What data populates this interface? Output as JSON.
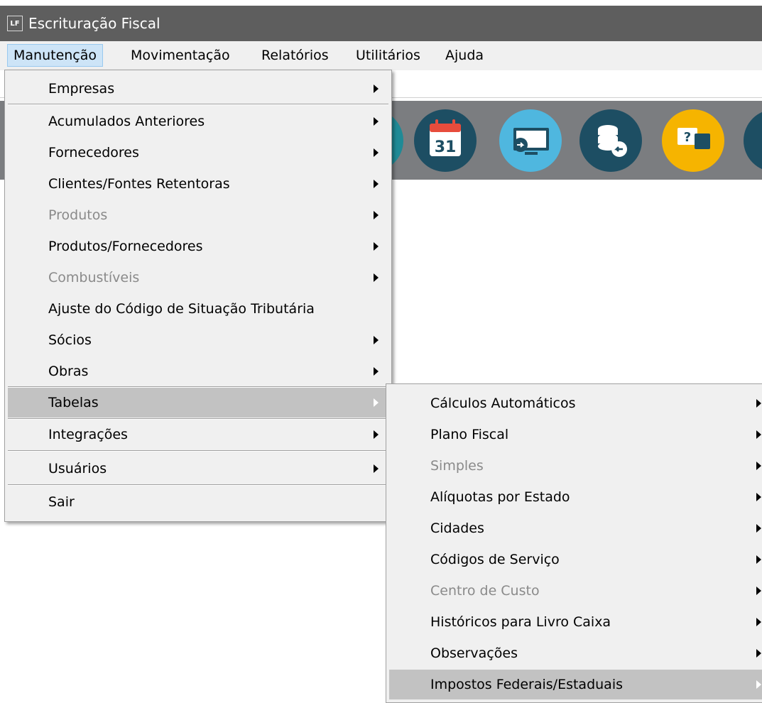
{
  "window": {
    "app_icon_text": "LF",
    "title": "Escrituração Fiscal"
  },
  "menubar": [
    "Manutenção",
    "Movimentação",
    "Relatórios",
    "Utilitários",
    "Ajuda"
  ],
  "toolbar": {
    "calendar_day": "31"
  },
  "menu_manutencao": {
    "items": [
      {
        "label": "Empresas",
        "has_submenu": true,
        "enabled": true
      },
      {
        "label": "Acumulados Anteriores",
        "has_submenu": true,
        "enabled": true
      },
      {
        "label": "Fornecedores",
        "has_submenu": true,
        "enabled": true
      },
      {
        "label": "Clientes/Fontes Retentoras",
        "has_submenu": true,
        "enabled": true
      },
      {
        "label": "Produtos",
        "has_submenu": true,
        "enabled": false
      },
      {
        "label": "Produtos/Fornecedores",
        "has_submenu": true,
        "enabled": true
      },
      {
        "label": "Combustíveis",
        "has_submenu": true,
        "enabled": false
      },
      {
        "label": "Ajuste do Código de Situação Tributária",
        "has_submenu": false,
        "enabled": true
      },
      {
        "label": "Sócios",
        "has_submenu": true,
        "enabled": true
      },
      {
        "label": "Obras",
        "has_submenu": true,
        "enabled": true
      },
      {
        "label": "Tabelas",
        "has_submenu": true,
        "enabled": true,
        "highlighted": true
      },
      {
        "label": "Integrações",
        "has_submenu": true,
        "enabled": true
      },
      {
        "label": "Usuários",
        "has_submenu": true,
        "enabled": true
      },
      {
        "label": "Sair",
        "has_submenu": false,
        "enabled": true
      }
    ]
  },
  "menu_tabelas": {
    "items": [
      {
        "label": "Cálculos Automáticos",
        "enabled": true
      },
      {
        "label": "Plano Fiscal",
        "enabled": true
      },
      {
        "label": "Simples",
        "enabled": false
      },
      {
        "label": "Alíquotas por Estado",
        "enabled": true
      },
      {
        "label": "Cidades",
        "enabled": true
      },
      {
        "label": "Códigos de Serviço",
        "enabled": true
      },
      {
        "label": "Centro de Custo",
        "enabled": false
      },
      {
        "label": "Históricos para Livro Caixa",
        "enabled": true
      },
      {
        "label": "Observações",
        "enabled": true
      },
      {
        "label": "Impostos Federais/Estaduais",
        "enabled": true,
        "highlighted": true
      }
    ]
  }
}
